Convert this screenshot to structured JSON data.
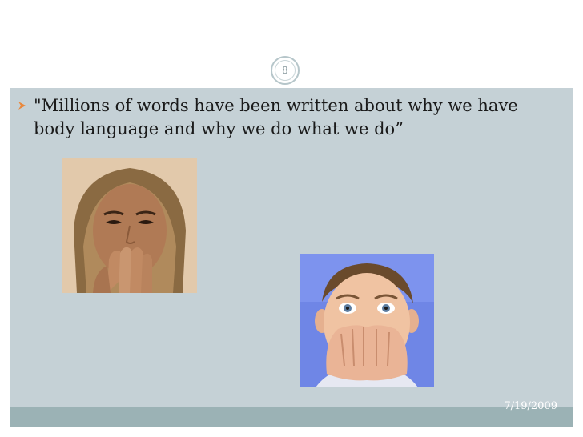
{
  "slide": {
    "number": "8",
    "bullet_text": "\"Millions of words have been written about why we have body language and why we do what we do”",
    "date": "7/19/2009"
  },
  "colors": {
    "content_bg": "#c5d1d6",
    "footer_bg": "#9bb2b5",
    "bullet": "#e9883c"
  }
}
